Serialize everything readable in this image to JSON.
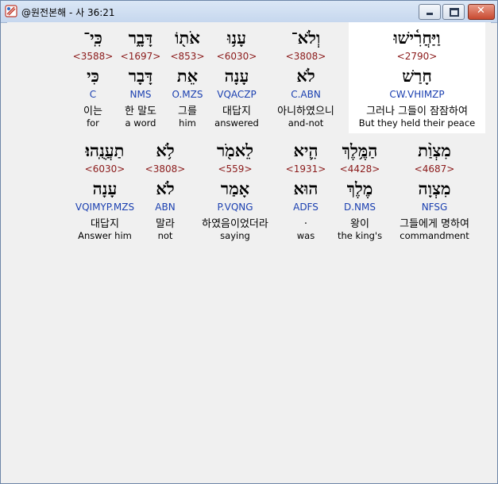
{
  "window": {
    "title": "@원전본해 - 사 36:21"
  },
  "rows": [
    [
      {
        "hebrew": "וַיַּחֲרִ֫ישׁוּ",
        "strong": "<2790>",
        "lemma": "חָרַשׁ",
        "parse": "CW.VHIMZP",
        "korean": "그러나 그들이 잠잠하여",
        "english": "But they held their peace",
        "highlight": true
      },
      {
        "hebrew": "וְלֹא־",
        "strong": "<3808>",
        "lemma": "לֹא",
        "parse": "C.ABN",
        "korean": "아니하였으니",
        "english": "and-not",
        "highlight": false
      },
      {
        "hebrew": "עָנ֥וּ",
        "strong": "<6030>",
        "lemma": "עָנָה",
        "parse": "VQACZP",
        "korean": "대답지",
        "english": "answered",
        "highlight": false
      },
      {
        "hebrew": "אֹת֖וֹ",
        "strong": "<853>",
        "lemma": "אֵת",
        "parse": "O.MZS",
        "korean": "그를",
        "english": "him",
        "highlight": false
      },
      {
        "hebrew": "דָּבָ֑ר",
        "strong": "<1697>",
        "lemma": "דָּבָר",
        "parse": "NMS",
        "korean": "한 말도",
        "english": "a word",
        "highlight": false
      },
      {
        "hebrew": "כִּֽי־",
        "strong": "<3588>",
        "lemma": "כִּי",
        "parse": "C",
        "korean": "이는",
        "english": "for",
        "highlight": false
      }
    ],
    [
      {
        "hebrew": "מִצְוַ֨ת",
        "strong": "<4687>",
        "lemma": "מִצְוָה",
        "parse": "NFSG",
        "korean": "그들에게 명하여",
        "english": "commandment",
        "highlight": false
      },
      {
        "hebrew": "הַמֶּ֥לֶךְ",
        "strong": "<4428>",
        "lemma": "מֶלֶךְ",
        "parse": "D.NMS",
        "korean": "왕이",
        "english": "the king's",
        "highlight": false
      },
      {
        "hebrew": "הִ֛יא",
        "strong": "<1931>",
        "lemma": "הוּא",
        "parse": "ADFS",
        "korean": ".",
        "english": "was",
        "highlight": false
      },
      {
        "hebrew": "לֵאמֹ֖ר",
        "strong": "<559>",
        "lemma": "אָמַר",
        "parse": "P.VQNG",
        "korean": "하였음이었더라",
        "english": "saying",
        "highlight": false
      },
      {
        "hebrew": "לֹ֥א",
        "strong": "<3808>",
        "lemma": "לֹא",
        "parse": "ABN",
        "korean": "말라",
        "english": "not",
        "highlight": false
      },
      {
        "hebrew": "תַעֲנֻֽהוּ׃",
        "strong": "<6030>",
        "lemma": "עָנָה",
        "parse": "VQIMYP.MZS",
        "korean": "대답지",
        "english": "Answer him",
        "highlight": false
      }
    ]
  ]
}
